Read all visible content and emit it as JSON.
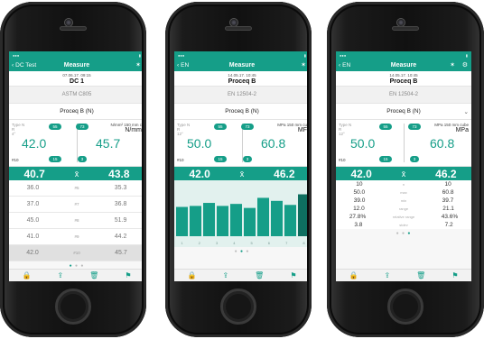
{
  "accent_color": "#159e88",
  "screens": [
    {
      "nav": {
        "back_label": "DC Test",
        "title": "Measure",
        "right_icon": "star-icon"
      },
      "info": {
        "date": "07.06.17. 09:15",
        "name": "DC 1"
      },
      "standard": "ASTM C805",
      "curve": "Proceq B (N)",
      "reading": {
        "label": "Type N\nR\n4°",
        "left_value": "42.0",
        "right_value": "45.7",
        "pill_top_left": "55",
        "pill_top_right": "73",
        "pill_bottom_left": "15",
        "pill_bottom_right": "3",
        "unit_small": "N/mm² 150 mm c",
        "unit_big": "N/mm",
        "count_label": "#10"
      },
      "summary": {
        "left": "40.7",
        "symbol": "x̄",
        "right": "43.8"
      },
      "rows": [
        {
          "a": "36.0",
          "n": "#5",
          "b": "35.3"
        },
        {
          "a": "37.0",
          "n": "#7",
          "b": "36.8"
        },
        {
          "a": "45.0",
          "n": "#8",
          "b": "51.9"
        },
        {
          "a": "41.0",
          "n": "#9",
          "b": "44.2"
        },
        {
          "a": "42.0",
          "n": "#10",
          "b": "45.7"
        }
      ],
      "dots": "● ● ●"
    },
    {
      "nav": {
        "back_label": "EN",
        "title": "Measure",
        "right_icon": "star-icon"
      },
      "info": {
        "date": "14.05.17. 10:45",
        "name": "Proceq B"
      },
      "standard": "EN 12504-2",
      "curve": "Proceq B (N)",
      "reading": {
        "label": "Type N\nR\n12°",
        "left_value": "50.0",
        "right_value": "60.8",
        "pill_top_left": "55",
        "pill_top_right": "73",
        "pill_bottom_left": "15",
        "pill_bottom_right": "3",
        "unit_small": "MPa 150 mm cu",
        "unit_big": "MF",
        "count_label": "#10"
      },
      "summary": {
        "left": "42.0",
        "symbol": "x̄",
        "right": "46.2"
      },
      "bars": [
        0.58,
        0.6,
        0.66,
        0.6,
        0.64,
        0.56,
        0.76,
        0.7,
        0.62,
        0.83
      ],
      "bar_axis": [
        "1",
        "2",
        "3",
        "4",
        "5",
        "6",
        "7",
        "8"
      ],
      "dots": "● ● ●"
    },
    {
      "nav": {
        "back_label": "EN",
        "title": "Measure",
        "right_icon": "star-icon",
        "right_icon2": "settings-icon"
      },
      "info": {
        "date": "14.05.17. 10:45",
        "name": "Proceq B"
      },
      "standard": "EN 12504-2",
      "curve": "Proceq B (N)",
      "reading": {
        "label": "Type N\nR\n12°",
        "left_value": "50.0",
        "right_value": "60.8",
        "pill_top_left": "55",
        "pill_top_right": "73",
        "pill_bottom_left": "15",
        "pill_bottom_right": "3",
        "unit_small": "MPa 150 mm cube",
        "unit_big": "MPa",
        "count_label": "#10"
      },
      "summary": {
        "left": "42.0",
        "symbol": "x̄",
        "right": "46.2"
      },
      "stats": [
        {
          "a": "10",
          "n": "n",
          "b": "10"
        },
        {
          "a": "50.0",
          "n": "max",
          "b": "60.8"
        },
        {
          "a": "39.0",
          "n": "min",
          "b": "39.7"
        },
        {
          "a": "12.0",
          "n": "range",
          "b": "21.1"
        },
        {
          "a": "27.8%",
          "n": "relative range",
          "b": "43.6%"
        },
        {
          "a": "3.8",
          "n": "stdev",
          "b": "7.2"
        }
      ],
      "dots": "● ● ●"
    }
  ]
}
